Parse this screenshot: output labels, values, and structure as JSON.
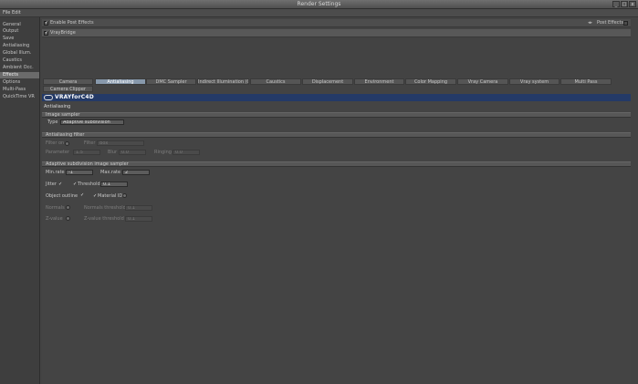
{
  "window": {
    "title": "Render Settings",
    "minimize": "_",
    "maximize": "□",
    "close": "x"
  },
  "menu": {
    "file": "File",
    "edit": "Edit"
  },
  "sidebar": {
    "items": [
      {
        "label": "General",
        "selected": false
      },
      {
        "label": "Output",
        "selected": false
      },
      {
        "label": "Save",
        "selected": false
      },
      {
        "label": "Antialiasing",
        "selected": false
      },
      {
        "label": "Global Illum.",
        "selected": false
      },
      {
        "label": "Caustics",
        "selected": false
      },
      {
        "label": "Ambient Occ.",
        "selected": false
      },
      {
        "label": "Effects",
        "selected": true
      },
      {
        "label": "Options",
        "selected": false
      },
      {
        "label": "Multi-Pass",
        "selected": false
      },
      {
        "label": "QuickTime VR",
        "selected": false
      }
    ]
  },
  "effects": {
    "enable_label": "Enable Post Effects",
    "enable_checked": true,
    "post_effects_button": "Post Effects",
    "vraybridge_label": "VrayBridge",
    "vraybridge_checked": true
  },
  "tabs": {
    "row1": [
      {
        "label": "Camera",
        "selected": false
      },
      {
        "label": "Antialiasing",
        "selected": true
      },
      {
        "label": "DMC Sampler",
        "selected": false
      },
      {
        "label": "Indirect Illumination (GI)",
        "selected": false
      },
      {
        "label": "Caustics",
        "selected": false
      },
      {
        "label": "Displacement",
        "selected": false
      },
      {
        "label": "Environment",
        "selected": false
      },
      {
        "label": "Color Mapping",
        "selected": false
      },
      {
        "label": "Vray Camera",
        "selected": false
      },
      {
        "label": "Vray system",
        "selected": false
      },
      {
        "label": "Multi Pass",
        "selected": false
      }
    ],
    "row2": [
      {
        "label": "Camera Clipper",
        "selected": false
      }
    ]
  },
  "banner": {
    "brand": "VRAYforC4D"
  },
  "panel": {
    "title": "Antialiasing"
  },
  "image_sampler": {
    "header": "Image sampler",
    "type_label": "Type",
    "type_value": "Adaptive subdivision"
  },
  "aa_filter": {
    "header": "Antialiasing filter",
    "filter_on_label": "Filter on",
    "filter_label": "Filter",
    "filter_value": "Box",
    "parameter_label": "Parameter",
    "parameter_value": "1.5",
    "blur_label": "Blur",
    "blur_value": "0.0",
    "ringing_label": "Ringing",
    "ringing_value": "0.0"
  },
  "adaptive": {
    "header": "Adaptive subdivision image sampler",
    "min_rate_label": "Min.rate",
    "min_rate_value": "-1",
    "max_rate_label": "Max.rate",
    "max_rate_value": "2",
    "jitter_label": "Jitter",
    "threshold_label": "Threshold",
    "threshold_value": "0.1",
    "object_outline_label": "Object outline",
    "material_id_label": "Material ID",
    "normals_label": "Normals",
    "normals_threshold_label": "Normals threshold",
    "normals_threshold_value": "0.1",
    "z_value_label": "Z-value",
    "z_value_threshold_label": "Z-value threshold",
    "z_value_threshold_value": "0.1"
  }
}
